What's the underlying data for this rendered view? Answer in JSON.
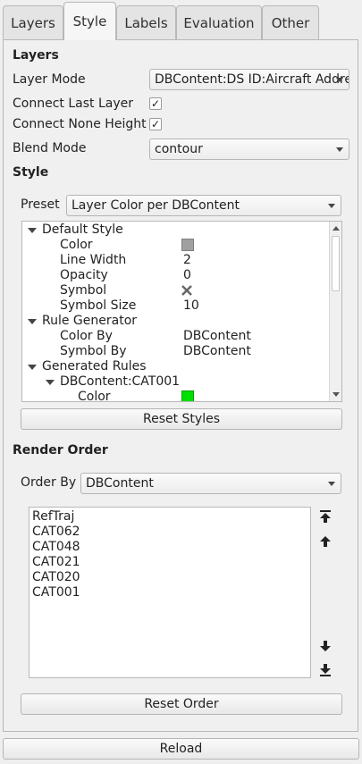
{
  "tabs": [
    {
      "label": "Layers",
      "active": false
    },
    {
      "label": "Style",
      "active": true
    },
    {
      "label": "Labels",
      "active": false
    },
    {
      "label": "Evaluation",
      "active": false
    },
    {
      "label": "Other",
      "active": false
    }
  ],
  "layers": {
    "section_title": "Layers",
    "layer_mode_label": "Layer Mode",
    "layer_mode_value": "DBContent:DS ID:Aircraft Address",
    "connect_last_layer_label": "Connect Last Layer",
    "connect_last_layer_checked": "✓",
    "connect_none_height_label": "Connect None Height",
    "connect_none_height_checked": "✓",
    "blend_mode_label": "Blend Mode",
    "blend_mode_value": "contour"
  },
  "style": {
    "section_title": "Style",
    "preset_label": "Preset",
    "preset_value": "Layer Color per DBContent",
    "tree": {
      "default_style": "Default Style",
      "color_label": "Color",
      "color_swatch": "#a0a0a0",
      "line_width_label": "Line Width",
      "line_width_value": "2",
      "opacity_label": "Opacity",
      "opacity_value": "0",
      "symbol_label": "Symbol",
      "symbol_icon": "x-mark-icon",
      "symbol_size_label": "Symbol Size",
      "symbol_size_value": "10",
      "rule_generator": "Rule Generator",
      "color_by_label": "Color By",
      "color_by_value": "DBContent",
      "symbol_by_label": "Symbol By",
      "symbol_by_value": "DBContent",
      "generated_rules": "Generated Rules",
      "cat001_node": "DBContent:CAT001",
      "cat001_color_label": "Color",
      "cat001_color_swatch": "#00e000"
    },
    "reset_styles_label": "Reset Styles"
  },
  "render_order": {
    "section_title": "Render Order",
    "order_by_label": "Order By",
    "order_by_value": "DBContent",
    "items": [
      "RefTraj",
      "CAT062",
      "CAT048",
      "CAT021",
      "CAT020",
      "CAT001"
    ],
    "reset_order_label": "Reset Order"
  },
  "reload_label": "Reload"
}
